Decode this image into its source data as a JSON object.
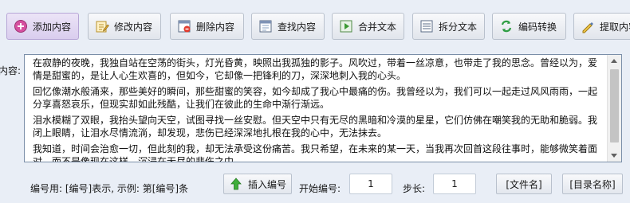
{
  "toolbar": {
    "buttons": [
      {
        "label": "添加内容",
        "icon": "add-icon"
      },
      {
        "label": "修改内容",
        "icon": "edit-icon"
      },
      {
        "label": "删除内容",
        "icon": "delete-icon"
      },
      {
        "label": "查找内容",
        "icon": "find-icon"
      },
      {
        "label": "合并文本",
        "icon": "merge-icon"
      },
      {
        "label": "拆分文本",
        "icon": "split-icon"
      },
      {
        "label": "编码转换",
        "icon": "convert-icon"
      },
      {
        "label": "提取内容",
        "icon": "extract-icon"
      }
    ]
  },
  "editor": {
    "label": "内容:",
    "paragraphs": [
      "在寂静的夜晚，我独自站在空荡的街头，灯光昏黄，映照出我孤独的影子。风吹过，带着一丝凉意，也带走了我的思念。曾经以为，爱情是甜蜜的，是让人心生欢喜的，但如今，它却像一把锋利的刀，深深地刺入我的心头。",
      "回忆像潮水般涌来，那些美好的瞬间，那些甜蜜的笑容，如今却成了我心中最痛的伤。我曾经以为，我们可以一起走过风风雨雨，一起分享喜怒哀乐，但现实却如此残酷，让我们在彼此的生命中渐行渐远。",
      "泪水模糊了双眼，我抬头望向天空，试图寻找一丝安慰。但天空中只有无尽的黑暗和冷漠的星星，它们仿佛在嘲笑我的无助和脆弱。我闭上眼睛，让泪水尽情流淌，却发现，悲伤已经深深地扎根在我的心中，无法抹去。",
      "我知道，时间会治愈一切，但此刻的我，却无法承受这份痛苦。我只希望，在未来的某一天，当我再次回首这段往事时，能够微笑着面对，而不是像现在这样，沉浸在无尽的悲伤之中。"
    ]
  },
  "bottom": {
    "hint": "编号用: [编号]表示, 示例: 第[编号]条",
    "insert_button": "插入编号",
    "start_label": "开始编号:",
    "start_value": "1",
    "step_label": "步长:",
    "step_value": "1",
    "filename_button": "[文件名]",
    "dirname_button": "[目录名称]"
  }
}
